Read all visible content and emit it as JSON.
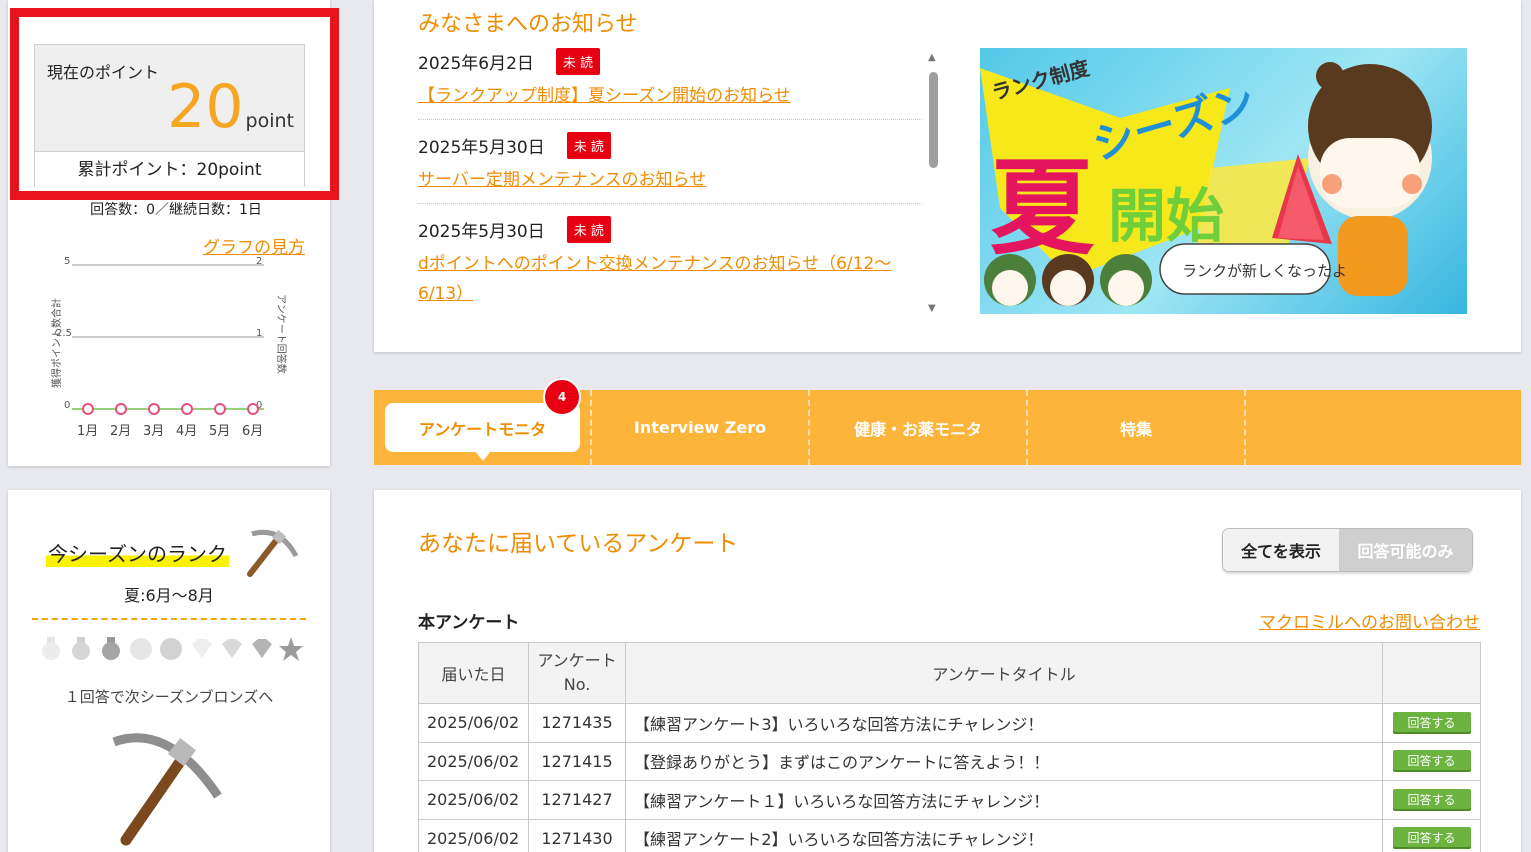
{
  "points": {
    "label": "現在のポイント",
    "value": "20",
    "unit": "point",
    "total": "累計ポイント：20point",
    "answer_info": "回答数：0／継続日数：1日",
    "graph_guide": "グラフの見方"
  },
  "graph": {
    "left_axis_label": "獲得ポイント数合計",
    "right_axis_label": "アンケート回答数",
    "left_ticks": [
      "5",
      "2.5",
      "0"
    ],
    "right_ticks": [
      "2",
      "1",
      "0"
    ],
    "months": [
      "1月",
      "2月",
      "3月",
      "4月",
      "5月",
      "6月"
    ],
    "values": [
      0,
      0,
      0,
      0,
      0,
      0
    ]
  },
  "rank": {
    "title": "今シーズンのランク",
    "season": "夏:6月～8月",
    "next": "１回答で次シーズンブロンズへ"
  },
  "news": {
    "title": "みなさまへのお知らせ",
    "items": [
      {
        "date": "2025年6月2日",
        "badge": "未 読",
        "link": "【ランクアップ制度】夏シーズン開始のお知らせ"
      },
      {
        "date": "2025年5月30日",
        "badge": "未 読",
        "link": "サーバー定期メンテナンスのお知らせ"
      },
      {
        "date": "2025年5月30日",
        "badge": "未 読",
        "link": "dポイントへのポイント交換メンテナンスのお知らせ（6/12～6/13）"
      }
    ],
    "banner": {
      "line1": "ランク制度",
      "big1": "夏",
      "big2": "シーズン",
      "big3": "開始",
      "bubble": "ランクが新しくなったよ"
    }
  },
  "tabs": {
    "count": "4",
    "items": [
      "アンケートモニタ",
      "Interview Zero",
      "健康・お薬モニタ",
      "特集"
    ]
  },
  "surveys": {
    "title": "あなたに届いているアンケート",
    "filter_all": "全てを表示",
    "filter_available": "回答可能のみ",
    "section": "本アンケート",
    "contact": "マクロミルへのお問い合わせ",
    "headers": [
      "届いた日",
      "アンケートNo.",
      "アンケートタイトル",
      ""
    ],
    "rows": [
      {
        "date": "2025/06/02",
        "no": "1271435",
        "title": "【練習アンケート3】いろいろな回答方法にチャレンジ！",
        "action": "回答する"
      },
      {
        "date": "2025/06/02",
        "no": "1271415",
        "title": "【登録ありがとう】まずはこのアンケートに答えよう！！",
        "action": "回答する"
      },
      {
        "date": "2025/06/02",
        "no": "1271427",
        "title": "【練習アンケート１】いろいろな回答方法にチャレンジ！",
        "action": "回答する"
      },
      {
        "date": "2025/06/02",
        "no": "1271430",
        "title": "【練習アンケート2】いろいろな回答方法にチャレンジ！",
        "action": "回答する"
      }
    ]
  },
  "colors": {
    "accent_orange": "#f08c00",
    "tab_bar": "#fcb53a",
    "unread_red": "#e60012",
    "answer_green": "#6db33f",
    "highlight_frame": "#e8141c"
  }
}
